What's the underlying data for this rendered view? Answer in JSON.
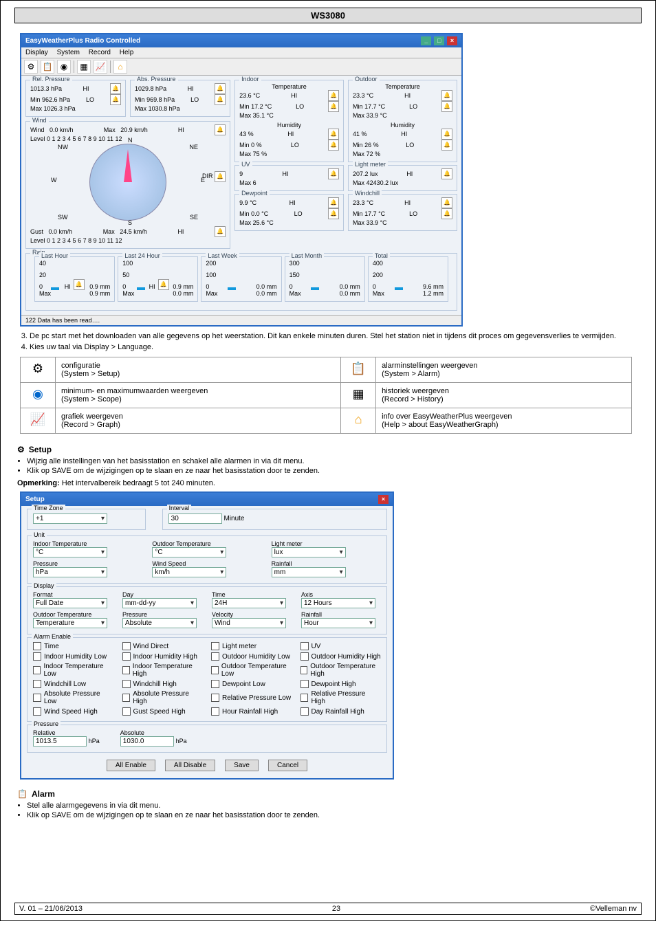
{
  "header": "WS3080",
  "win1": {
    "title": "EasyWeatherPlus Radio Controlled",
    "menu": [
      "Display",
      "System",
      "Record",
      "Help"
    ],
    "toolbar_icons": [
      "setup-icon",
      "alarm-icon",
      "scope-icon",
      "history-icon",
      "graph-icon",
      "home-icon"
    ],
    "rel_pressure": {
      "label": "Rel. Pressure",
      "value": "1013.3 hPa",
      "hi": "HI",
      "min_lbl": "Min",
      "min": "962.6 hPa",
      "max_lbl": "Max",
      "max": "1026.3 hPa",
      "lo": "LO"
    },
    "abs_pressure": {
      "label": "Abs. Pressure",
      "value": "1029.8 hPa",
      "hi": "HI",
      "min_lbl": "Min",
      "min": "969.8 hPa",
      "max_lbl": "Max",
      "max": "1030.8 hPa",
      "lo": "LO"
    },
    "wind": {
      "label": "Wind",
      "row1_lbl": "Wind",
      "row1": "0.0 km/h",
      "row2_lbl": "Max",
      "row2": "20.9 km/h",
      "hi": "HI",
      "level_lbl": "Level",
      "scale": "0  1  2  3  4  5  6  7  8  9  10  11  12",
      "gust_lbl": "Gust",
      "gust": "0.0 km/h",
      "gust_max_lbl": "Max",
      "gust_max": "24.5 km/h",
      "dir_lbl": "DIR",
      "nw": "NW",
      "ne": "NE",
      "w": "W",
      "e": "E",
      "sw": "SW",
      "se": "SE",
      "n": "N",
      "s": "S"
    },
    "indoor": {
      "label": "Indoor",
      "temp_lbl": "Temperature",
      "temp": "23.6 °C",
      "hi": "HI",
      "min_lbl": "Min",
      "min": "17.2 °C",
      "max_lbl": "Max",
      "max": "35.1 °C",
      "lo": "LO",
      "hum_lbl": "Humidity",
      "hum": "43 %",
      "hmin_lbl": "Min",
      "hmin": "0 %",
      "hmax_lbl": "Max",
      "hmax": "75 %"
    },
    "outdoor": {
      "label": "Outdoor",
      "temp_lbl": "Temperature",
      "temp": "23.3 °C",
      "hi": "HI",
      "min_lbl": "Min",
      "min": "17.7 °C",
      "max_lbl": "Max",
      "max": "33.9 °C",
      "lo": "LO",
      "hum_lbl": "Humidity",
      "hum": "41 %",
      "hmin_lbl": "Min",
      "hmin": "26 %",
      "hmax_lbl": "Max",
      "hmax": "72 %"
    },
    "uv": {
      "label": "UV",
      "value": "9",
      "hi": "HI",
      "max_lbl": "Max",
      "max": "6"
    },
    "light": {
      "label": "Light meter",
      "value": "207.2 lux",
      "hi": "HI",
      "max_lbl": "Max",
      "max": "42430.2 lux"
    },
    "dew": {
      "label": "Dewpoint",
      "value": "9.9 °C",
      "hi": "HI",
      "min_lbl": "Min",
      "min": "0.0 °C",
      "max_lbl": "Max",
      "max": "25.6 °C",
      "lo": "LO"
    },
    "windchill": {
      "label": "Windchill",
      "value": "23.3 °C",
      "hi": "HI",
      "min_lbl": "Min",
      "min": "17.7 °C",
      "max_lbl": "Max",
      "max": "33.9 °C",
      "lo": "LO"
    },
    "rain": {
      "label": "Rain",
      "boxes": [
        {
          "lbl": "Last Hour",
          "top": "40",
          "mid": "20",
          "bot": "0",
          "hi": "HI",
          "cur": "0.9 mm",
          "max_lbl": "Max",
          "max": "0.9 mm"
        },
        {
          "lbl": "Last 24 Hour",
          "top": "100",
          "mid": "50",
          "bot": "0",
          "hi": "HI",
          "cur": "0.9 mm",
          "max_lbl": "Max",
          "max": "0.0 mm"
        },
        {
          "lbl": "Last Week",
          "top": "200",
          "mid": "100",
          "bot": "0",
          "cur": "0.0 mm",
          "max_lbl": "Max",
          "max": "0.0 mm"
        },
        {
          "lbl": "Last Month",
          "top": "300",
          "mid": "150",
          "bot": "0",
          "cur": "0.0 mm",
          "max_lbl": "Max",
          "max": "0.0 mm"
        },
        {
          "lbl": "Total",
          "top": "400",
          "mid": "200",
          "bot": "0",
          "cur": "9.6 mm",
          "max_lbl": "Max",
          "max": "1.2 mm"
        }
      ]
    },
    "status": "122 Data has been read…."
  },
  "step3": {
    "num": "3.",
    "text": "De pc start met het downloaden van alle gegevens op het weerstation. Dit kan enkele minuten duren. Stel het station niet in tijdens dit proces om gegevensverlies te vermijden."
  },
  "step4": {
    "num": "4.",
    "text": "Kies uw taal via Display > Language."
  },
  "table": {
    "r1c1": {
      "t1": "configuratie",
      "t2": "(System > Setup)"
    },
    "r1c2": {
      "t1": "alarminstellingen weergeven",
      "t2": "(System > Alarm)"
    },
    "r2c1": {
      "t1": "minimum- en maximumwaarden weergeven",
      "t2": "(System > Scope)"
    },
    "r2c2": {
      "t1": "historiek weergeven",
      "t2": "(Record > History)"
    },
    "r3c1": {
      "t1": "grafiek weergeven",
      "t2": "(Record > Graph)"
    },
    "r3c2": {
      "t1": "info over EasyWeatherPlus weergeven",
      "t2": "(Help > about EasyWeatherGraph)"
    }
  },
  "setup": {
    "title": "Setup",
    "b1": "Wijzig alle instellingen van het basisstation en schakel alle alarmen in via dit menu.",
    "b2": "Klik op SAVE om de wijzigingen op te slaan en ze naar het basisstation door te zenden.",
    "note_lbl": "Opmerking:",
    "note": " Het intervalbereik bedraagt 5 tot 240 minuten.",
    "win_title": "Setup",
    "tz_lbl": "Time Zone",
    "tz": "+1",
    "int_lbl": "Interval",
    "int": "30",
    "int_unit": "Minute",
    "unit_lbl": "Unit",
    "u1": {
      "l": "Indoor Temperature",
      "v": "°C"
    },
    "u2": {
      "l": "Outdoor Temperature",
      "v": "°C"
    },
    "u3": {
      "l": "Light meter",
      "v": "lux"
    },
    "u4": {
      "l": "Pressure",
      "v": "hPa"
    },
    "u5": {
      "l": "Wind Speed",
      "v": "km/h"
    },
    "u6": {
      "l": "Rainfall",
      "v": "mm"
    },
    "disp_lbl": "Display",
    "d1": {
      "l": "Format",
      "v": "Full Date"
    },
    "d2": {
      "l": "Day",
      "v": "mm-dd-yy"
    },
    "d3": {
      "l": "Time",
      "v": "24H"
    },
    "d4": {
      "l": "Axis",
      "v": "12 Hours"
    },
    "d5": {
      "l": "Outdoor Temperature",
      "v": "Temperature"
    },
    "d6": {
      "l": "Pressure",
      "v": "Absolute"
    },
    "d7": {
      "l": "Velocity",
      "v": "Wind"
    },
    "d8": {
      "l": "Rainfall",
      "v": "Hour"
    },
    "alarm_lbl": "Alarm Enable",
    "alarms": [
      "Time",
      "Wind Direct",
      "Light meter",
      "UV",
      "Indoor Humidity Low",
      "Indoor Humidity High",
      "Outdoor Humidity Low",
      "Outdoor Humidity High",
      "Indoor Temperature Low",
      "Indoor Temperature High",
      "Outdoor Temperature Low",
      "Outdoor Temperature High",
      "Windchill Low",
      "Windchill High",
      "Dewpoint Low",
      "Dewpoint High",
      "Absolute Pressure Low",
      "Absolute Pressure High",
      "Relative Pressure Low",
      "Relative Pressure High",
      "Wind Speed High",
      "Gust Speed High",
      "Hour Rainfall High",
      "Day Rainfall High"
    ],
    "press_lbl": "Pressure",
    "rel_lbl": "Relative",
    "rel": "1013.5",
    "abs_lbl": "Absolute",
    "abs": "1030.0",
    "unit": "hPa",
    "btn1": "All Enable",
    "btn2": "All Disable",
    "btn3": "Save",
    "btn4": "Cancel"
  },
  "alarm": {
    "title": "Alarm",
    "b1": "Stel alle alarmgegevens in via dit menu.",
    "b2": "Klik op SAVE om de wijzigingen op te slaan en ze naar het basisstation door te zenden."
  },
  "footer": {
    "l": "V. 01 – 21/06/2013",
    "c": "23",
    "r": "©Velleman nv"
  }
}
